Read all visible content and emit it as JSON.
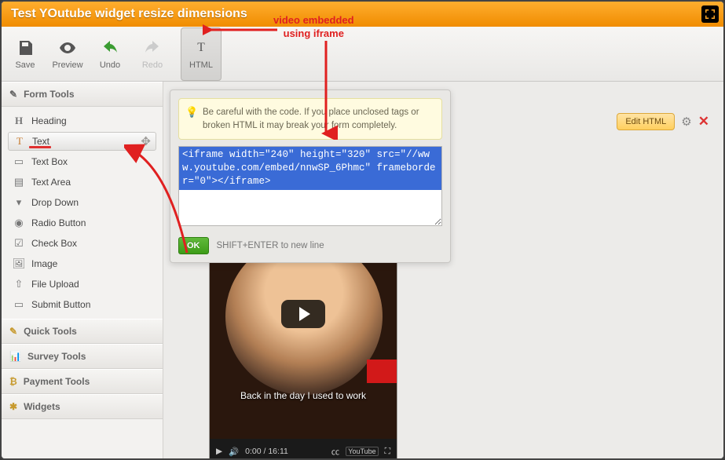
{
  "window": {
    "title": "Test YOutube widget resize dimensions"
  },
  "toolbar": {
    "save": "Save",
    "preview": "Preview",
    "undo": "Undo",
    "redo": "Redo",
    "html": "HTML"
  },
  "sidebar": {
    "sections": {
      "form_tools": "Form Tools",
      "quick_tools": "Quick Tools",
      "survey_tools": "Survey Tools",
      "payment_tools": "Payment Tools",
      "widgets": "Widgets"
    },
    "form_tools_items": [
      {
        "label": "Heading"
      },
      {
        "label": "Text"
      },
      {
        "label": "Text Box"
      },
      {
        "label": "Text Area"
      },
      {
        "label": "Drop Down"
      },
      {
        "label": "Radio Button"
      },
      {
        "label": "Check Box"
      },
      {
        "label": "Image"
      },
      {
        "label": "File Upload"
      },
      {
        "label": "Submit Button"
      }
    ]
  },
  "editor": {
    "tip": "Be careful with the code. If you place unclosed tags or broken HTML it may break your form completely.",
    "code": "<iframe width=\"240\" height=\"320\" src=\"//www.youtube.com/embed/nnwSP_6Phmc\" frameborder=\"0\"></iframe>",
    "ok": "OK",
    "hint": "SHIFT+ENTER to new line"
  },
  "annotation": {
    "line1": "video embedded",
    "line2": "using iframe"
  },
  "video": {
    "caption": "Back in the day I used to work",
    "time": "0:00 / 16:11",
    "youtube_badge": "YouTube"
  },
  "actions": {
    "edit_html": "Edit HTML"
  }
}
